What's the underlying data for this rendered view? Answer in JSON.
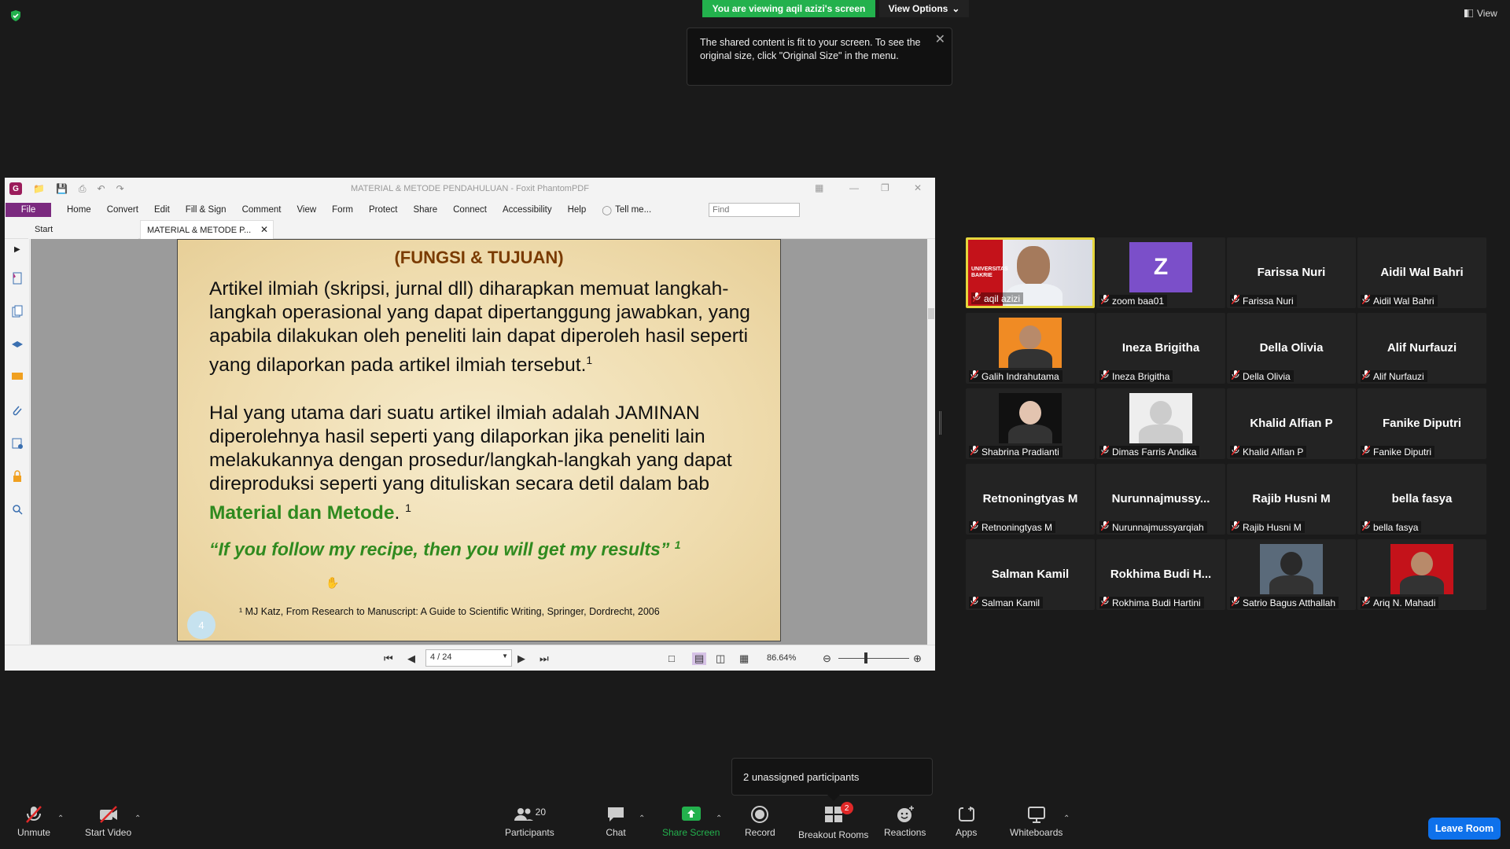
{
  "banner": {
    "viewing_text": "You are viewing aqil azizi's screen",
    "view_options": "View Options",
    "top_view": "View"
  },
  "tooltip": {
    "text": "The shared content is fit to your screen. To see the original size, click \"Original Size\" in the menu."
  },
  "foxit": {
    "window_title": "MATERIAL & METODE PENDAHULUAN - Foxit PhantomPDF",
    "menu": [
      "File",
      "Home",
      "Convert",
      "Edit",
      "Fill & Sign",
      "Comment",
      "View",
      "Form",
      "Protect",
      "Share",
      "Connect",
      "Accessibility",
      "Help"
    ],
    "tell_me": "Tell me...",
    "find_placeholder": "Find",
    "tabs": {
      "start": "Start",
      "doc": "MATERIAL & METODE P..."
    },
    "page_box": "4 / 24",
    "zoom": "86.64%"
  },
  "slide": {
    "title": "(FUNGSI & TUJUAN)",
    "para1": "Artikel ilmiah (skripsi, jurnal dll) diharapkan memuat langkah-langkah operasional yang dapat dipertanggung jawabkan, yang apabila dilakukan oleh peneliti lain dapat diperoleh hasil seperti yang dilaporkan pada artikel ilmiah tersebut.",
    "para2": "Hal yang utama dari suatu artikel ilmiah adalah JAMINAN diperolehnya hasil seperti yang dilaporkan jika peneliti lain melakukannya dengan prosedur/langkah-langkah yang dapat direproduksi seperti yang dituliskan secara detil dalam bab",
    "para2_green": "Material dan Metode",
    "para2_end": ".",
    "sup": "1",
    "quote": "“If you follow my recipe, then you will get my results”",
    "page_number": "4",
    "footnote": "¹ MJ Katz, From Research to Manuscript: A Guide to Scientific Writing, Springer, Dordrecht, 2006"
  },
  "gallery": [
    {
      "name": "",
      "label": "aqil azizi"
    },
    {
      "name": "",
      "label": "zoom baa01"
    },
    {
      "name": "Farissa Nuri",
      "label": "Farissa Nuri"
    },
    {
      "name": "Aidil Wal Bahri",
      "label": "Aidil Wal Bahri"
    },
    {
      "name": "",
      "label": "Galih Indrahutama"
    },
    {
      "name": "Ineza Brigitha",
      "label": "Ineza Brigitha"
    },
    {
      "name": "Della Olivia",
      "label": "Della Olivia"
    },
    {
      "name": "Alif Nurfauzi",
      "label": "Alif Nurfauzi"
    },
    {
      "name": "",
      "label": "Shabrina Pradianti"
    },
    {
      "name": "",
      "label": "Dimas Farris Andika"
    },
    {
      "name": "Khalid Alfian P",
      "label": "Khalid Alfian P"
    },
    {
      "name": "Fanike Diputri",
      "label": "Fanike Diputri"
    },
    {
      "name": "Retnoningtyas M",
      "label": "Retnoningtyas M"
    },
    {
      "name": "Nurunnajmussy...",
      "label": "Nurunnajmussyarqiah"
    },
    {
      "name": "Rajib Husni M",
      "label": "Rajib Husni M"
    },
    {
      "name": "bella fasya",
      "label": "bella fasya"
    },
    {
      "name": "Salman Kamil",
      "label": "Salman Kamil"
    },
    {
      "name": "Rokhima Budi H...",
      "label": "Rokhima Budi Hartini"
    },
    {
      "name": "",
      "label": "Satrio Bagus Atthallah"
    },
    {
      "name": "",
      "label": "Ariq N. Mahadi"
    }
  ],
  "zoom_letter": "Z",
  "popup": {
    "text": "2 unassigned participants"
  },
  "toolbar": {
    "unmute": "Unmute",
    "start_video": "Start Video",
    "participants": "Participants",
    "participants_count": "20",
    "chat": "Chat",
    "share": "Share Screen",
    "record": "Record",
    "breakout": "Breakout Rooms",
    "breakout_badge": "2",
    "reactions": "Reactions",
    "apps": "Apps",
    "whiteboards": "Whiteboards",
    "leave": "Leave Room"
  },
  "colors": {
    "share_green": "#23b14d",
    "leave_blue": "#0e71eb",
    "speaker_border": "#e5d63d",
    "foxit_purple": "#7b2a7f"
  }
}
